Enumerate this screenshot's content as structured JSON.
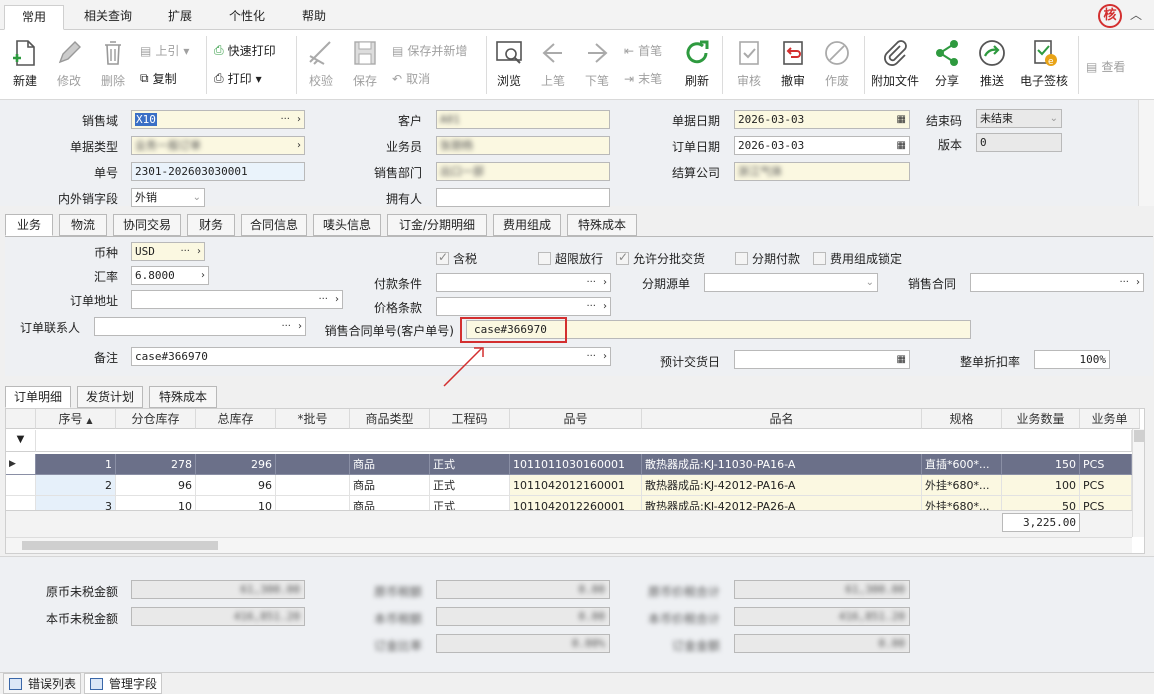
{
  "menu_tabs": [
    "常用",
    "相关查询",
    "扩展",
    "个性化",
    "帮助"
  ],
  "badge": "核",
  "toolbar": {
    "new": "新建",
    "edit": "修改",
    "delete": "删除",
    "prev_ref": "上引",
    "copy": "复制",
    "quick_print": "快速打印",
    "print": "打印",
    "verify": "校验",
    "save": "保存",
    "save_new": "保存并新增",
    "cancel": "取消",
    "browse": "浏览",
    "prev": "上笔",
    "next": "下笔",
    "first": "首笔",
    "last": "末笔",
    "refresh": "刷新",
    "audit": "审核",
    "unaudit": "撤审",
    "void": "作废",
    "attach": "附加文件",
    "share": "分享",
    "push": "推送",
    "esign": "电子签核",
    "view": "查看"
  },
  "header": {
    "sales_domain_label": "销售域",
    "sales_domain_value": "X10",
    "doc_type_label": "单据类型",
    "doc_type_value": "业务一般订单",
    "doc_no_label": "单号",
    "doc_no_value": "2301-202603030001",
    "domestic_label": "内外销字段",
    "domestic_value": "外销",
    "customer_label": "客户",
    "customer_value": "A01",
    "salesman_label": "业务员",
    "salesman_value": "张朋杨",
    "sales_dept_label": "销售部门",
    "sales_dept_value": "出口一部",
    "owner_label": "拥有人",
    "doc_date_label": "单据日期",
    "doc_date_value": "2026-03-03",
    "order_date_label": "订单日期",
    "order_date_value": "2026-03-03",
    "settle_co_label": "结算公司",
    "settle_co_value": "浙江气体",
    "close_code_label": "结束码",
    "close_code_value": "未结束",
    "version_label": "版本",
    "version_value": "0"
  },
  "detail_tabs": [
    "业务",
    "物流",
    "协同交易",
    "财务",
    "合同信息",
    "唛头信息",
    "订金/分期明细",
    "费用组成",
    "特殊成本"
  ],
  "business": {
    "currency_label": "币种",
    "currency_value": "USD",
    "rate_label": "汇率",
    "rate_value": "6.8000",
    "address_label": "订单地址",
    "contact_label": "订单联系人",
    "remark_label": "备注",
    "remark_value": "case#366970",
    "tax_label": "含税",
    "over_release_label": "超限放行",
    "batch_deliver_label": "允许分批交货",
    "installment_label": "分期付款",
    "fee_lock_label": "费用组成锁定",
    "pay_terms_label": "付款条件",
    "price_terms_label": "价格条款",
    "contract_no_label": "销售合同单号(客户单号)",
    "contract_no_value": "case#366970",
    "install_source_label": "分期源单",
    "sales_contract_label": "销售合同",
    "delivery_date_label": "预计交货日",
    "discount_label": "整单折扣率",
    "discount_value": "100%"
  },
  "grid_tabs": [
    "订单明细",
    "发货计划",
    "特殊成本"
  ],
  "grid": {
    "columns": [
      "序号",
      "分仓库存",
      "总库存",
      "*批号",
      "商品类型",
      "工程码",
      "品号",
      "品名",
      "规格",
      "业务数量",
      "业务单"
    ],
    "rows": [
      [
        "1",
        "278",
        "296",
        "",
        "商品",
        "正式",
        "1011011030160001",
        "散热器成品:KJ-11030-PA16-A",
        "直插*600*...",
        "150",
        "PCS"
      ],
      [
        "2",
        "96",
        "96",
        "",
        "商品",
        "正式",
        "1011042012160001",
        "散热器成品:KJ-42012-PA16-A",
        "外挂*680*...",
        "100",
        "PCS"
      ],
      [
        "3",
        "10",
        "10",
        "",
        "商品",
        "正式",
        "1011042012260001",
        "散热器成品:KJ-42012-PA26-A",
        "外挂*680*...",
        "50",
        "PCS"
      ]
    ],
    "total_qty": "3,225.00"
  },
  "summary": {
    "orig_untaxed_label": "原币未税金额",
    "orig_untaxed_value": "61,300.00",
    "local_untaxed_label": "本币未税金额",
    "local_untaxed_value": "416,851.20",
    "col2_labels": [
      "原币税额",
      "本币税额",
      "订金比率"
    ],
    "col2_values": [
      "0.00",
      "0.00",
      "0.00%"
    ],
    "col3_labels": [
      "原币价税合计",
      "本币价税合计",
      "订金金额"
    ],
    "col3_values": [
      "61,300.00",
      "416,851.20",
      "0.00"
    ]
  },
  "status_tabs": [
    "错误列表",
    "管理字段"
  ],
  "colors": {
    "accent_green": "#2e9a3f",
    "accent_blue": "#2f6db5",
    "highlight_red": "#d32f2f",
    "selected_row": "#6b7089"
  }
}
